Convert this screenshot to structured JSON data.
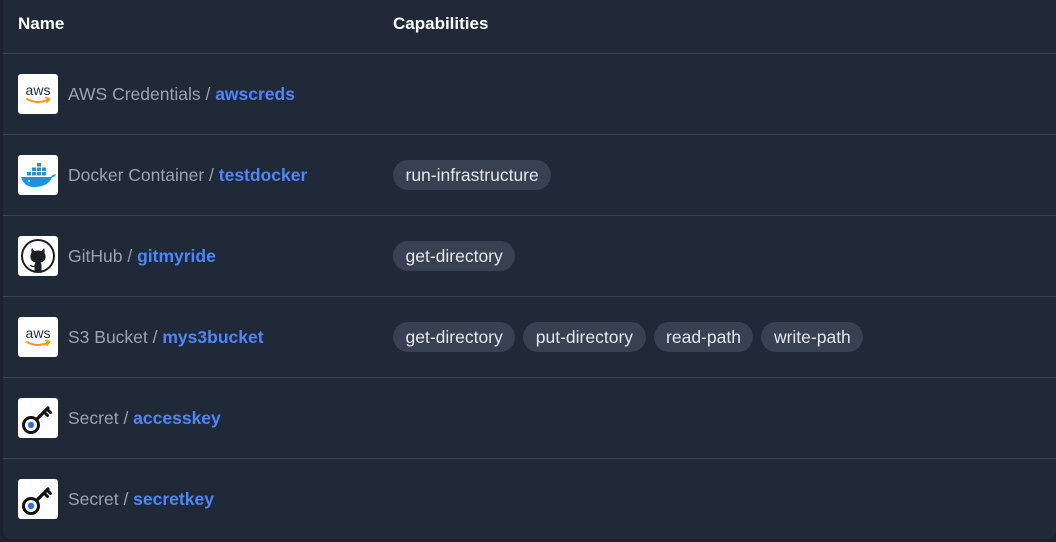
{
  "header": {
    "name_label": "Name",
    "capabilities_label": "Capabilities"
  },
  "rows": [
    {
      "icon": "aws-icon",
      "logo_text": "aws",
      "type": "AWS Credentials",
      "sep": " / ",
      "id": "awscreds",
      "capabilities": []
    },
    {
      "icon": "docker-icon",
      "type": "Docker Container",
      "sep": " / ",
      "id": "testdocker",
      "capabilities": [
        "run-infrastructure"
      ]
    },
    {
      "icon": "github-icon",
      "type": "GitHub",
      "sep": " / ",
      "id": "gitmyride",
      "capabilities": [
        "get-directory"
      ]
    },
    {
      "icon": "aws-icon",
      "logo_text": "aws",
      "type": "S3 Bucket",
      "sep": " / ",
      "id": "mys3bucket",
      "capabilities": [
        "get-directory",
        "put-directory",
        "read-path",
        "write-path"
      ]
    },
    {
      "icon": "key-icon",
      "type": "Secret",
      "sep": " / ",
      "id": "accesskey",
      "capabilities": []
    },
    {
      "icon": "key-icon",
      "type": "Secret",
      "sep": " / ",
      "id": "secretkey",
      "capabilities": []
    }
  ],
  "colors": {
    "background": "#1f2937",
    "link": "#4f86f7",
    "pill": "#374151",
    "aws_orange": "#ff9900",
    "docker_blue": "#1d91e6",
    "key_blue": "#2f6fe8"
  }
}
